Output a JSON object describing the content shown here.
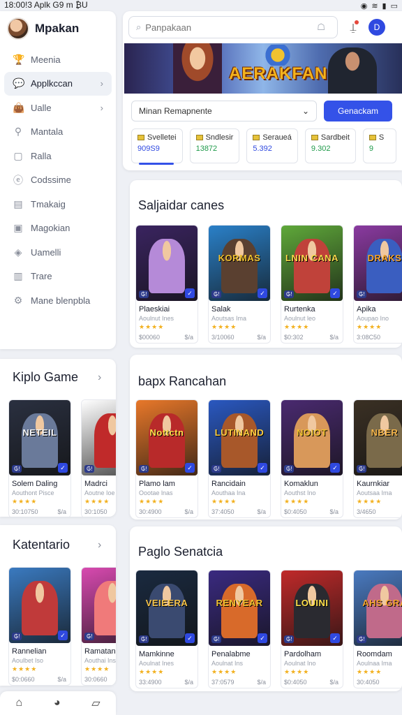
{
  "status": {
    "time": "18:00!3",
    "carrier": "Aplk G9 m ₿U"
  },
  "brand": {
    "name": "Mpakan"
  },
  "nav": [
    {
      "label": "Meenia",
      "icon": "trophy-icon",
      "glyph": "🏆",
      "active": false,
      "chevron": false
    },
    {
      "label": "Applkccan",
      "icon": "chat-icon",
      "glyph": "💬",
      "active": true,
      "chevron": true
    },
    {
      "label": "Ualle",
      "icon": "bag-icon",
      "glyph": "👜",
      "active": false,
      "chevron": true
    },
    {
      "label": "Mantala",
      "icon": "location-icon",
      "glyph": "⚲",
      "active": false,
      "chevron": false
    },
    {
      "label": "Ralla",
      "icon": "square-icon",
      "glyph": "▢",
      "active": false,
      "chevron": false
    },
    {
      "label": "Codssime",
      "icon": "circle-e-icon",
      "glyph": "ⓔ",
      "active": false,
      "chevron": false
    },
    {
      "label": "Tmakaig",
      "icon": "document-icon",
      "glyph": "▤",
      "active": false,
      "chevron": false
    },
    {
      "label": "Magokian",
      "icon": "image-icon",
      "glyph": "▣",
      "active": false,
      "chevron": false
    },
    {
      "label": "Uamelli",
      "icon": "diamond-icon",
      "glyph": "◈",
      "active": false,
      "chevron": false
    },
    {
      "label": "Trare",
      "icon": "clipboard-icon",
      "glyph": "▥",
      "active": false,
      "chevron": false
    },
    {
      "label": "Mane blenpbla",
      "icon": "settings-icon",
      "glyph": "⚙",
      "active": false,
      "chevron": false
    }
  ],
  "search": {
    "placeholder": "Panpakaan"
  },
  "header": {
    "user_initial": "D"
  },
  "banner": {
    "title": "AERAKFAN"
  },
  "filter": {
    "selected": "Minan Remapnente",
    "button": "Genackam"
  },
  "stats": [
    {
      "label": "Svelletei",
      "value": "909S9",
      "color": "#2f49e0",
      "active": true
    },
    {
      "label": "Sndlesir",
      "value": "13872",
      "color": "#1f9a4a",
      "active": false
    },
    {
      "label": "Seraueá",
      "value": "5.392",
      "color": "#2f49e0",
      "active": false
    },
    {
      "label": "Sardbeit",
      "value": "9.302",
      "color": "#1f9a4a",
      "active": false
    },
    {
      "label": "S",
      "value": "9",
      "color": "#1f9a4a",
      "active": false
    }
  ],
  "sections": {
    "s1": {
      "title": "Saljaidar canes",
      "games": [
        {
          "name": "Plaeskiai",
          "sub": "Aoulnut Ines",
          "price": "$00060",
          "tag": "$/a",
          "art_title": "",
          "bg": "#3a2460",
          "fig": "#b58ad8",
          "accent": "#f5c34a"
        },
        {
          "name": "Salak",
          "sub": "Aoutsas Ima",
          "price": "3/10060",
          "tag": "$/a",
          "art_title": "KORMAS",
          "bg": "#2a80c8",
          "fig": "#5a4030",
          "accent": "#f1c230"
        },
        {
          "name": "Rurtenka",
          "sub": "Aoulnut leo",
          "price": "$0:302",
          "tag": "$/a",
          "art_title": "LNIN CANA",
          "bg": "#5fa83a",
          "fig": "#c0423a",
          "accent": "#f6d84a"
        },
        {
          "name": "Apika",
          "sub": "Aoupao Ino",
          "price": "3:08C50",
          "tag": "$/a",
          "art_title": "DRAKS",
          "bg": "#8a3aa0",
          "fig": "#3a5ec0",
          "accent": "#f5a530"
        }
      ]
    },
    "s2": {
      "title": "bapx Rancahan",
      "games": [
        {
          "name": "Plamo lam",
          "sub": "Oootae lnas",
          "price": "30:4900",
          "tag": "$/a",
          "art_title": "Nottctn",
          "bg": "#e8782a",
          "fig": "#b82a2a",
          "accent": "#ffe04a"
        },
        {
          "name": "Rancidain",
          "sub": "Aouthaa Ina",
          "price": "37:4050",
          "tag": "$/a",
          "art_title": "LUTINAND",
          "bg": "#2a58c0",
          "fig": "#a8582a",
          "accent": "#ffd040"
        },
        {
          "name": "Komaklun",
          "sub": "Aouthst Ino",
          "price": "$0:4050",
          "tag": "$/a",
          "art_title": "NOIOT",
          "bg": "#4a2a70",
          "fig": "#d8985a",
          "accent": "#f1c230"
        },
        {
          "name": "Kaurnkiar",
          "sub": "Aoutsaa Ima",
          "price": "3/4650",
          "tag": "$/a",
          "art_title": "NBER",
          "bg": "#3a3024",
          "fig": "#7a6a4a",
          "accent": "#f5b54a"
        }
      ]
    },
    "s3": {
      "title": "Paglo Senatcia",
      "games": [
        {
          "name": "Mamkinne",
          "sub": "Aoulnat Ines",
          "price": "33:4900",
          "tag": "$/a",
          "art_title": "VEIEERA",
          "bg": "#1a2a40",
          "fig": "#3a4a70",
          "accent": "#f5c34a"
        },
        {
          "name": "Penalabme",
          "sub": "Aoulnat Ins",
          "price": "37:0579",
          "tag": "$/a",
          "art_title": "RENYEAR",
          "bg": "#3a2a80",
          "fig": "#d86a2a",
          "accent": "#f1c230"
        },
        {
          "name": "Pardolham",
          "sub": "Aoulnat Ino",
          "price": "$0:4050",
          "tag": "$/a",
          "art_title": "LOUINI",
          "bg": "#c02a2a",
          "fig": "#2a2a30",
          "accent": "#ffe04a"
        },
        {
          "name": "Roomdam",
          "sub": "Aoulnaa Ima",
          "price": "30:4050",
          "tag": "$/a",
          "art_title": "AHS GRA",
          "bg": "#4a7ac0",
          "fig": "#c06a8a",
          "accent": "#f5a530"
        }
      ]
    },
    "k1": {
      "title": "Kiplo Game",
      "games": [
        {
          "name": "Solem Daling",
          "sub": "Aouthont Pisce",
          "price": "30:10750",
          "tag": "$/a",
          "art_title": "NETEIL",
          "bg": "#2a3040",
          "fig": "#6a7a9a",
          "accent": "#f5f5f5"
        },
        {
          "name": "Madrci",
          "sub": "Aoutne Ioe",
          "price": "30:1050",
          "tag": "$/a",
          "art_title": "",
          "bg": "#ffffff",
          "fig": "#c02a2a",
          "accent": "#333"
        }
      ]
    },
    "k2": {
      "title": "Katentario",
      "games": [
        {
          "name": "Rannelian",
          "sub": "Aoulbet Iso",
          "price": "$0:0660",
          "tag": "$/a",
          "art_title": "",
          "bg": "#3a7ac0",
          "fig": "#c03a3a",
          "accent": "#f1c230"
        },
        {
          "name": "Ramatann",
          "sub": "Aouthai Ins",
          "price": "30:0660",
          "tag": "$/a",
          "art_title": "",
          "bg": "#d84ab0",
          "fig": "#f07a7a",
          "accent": "#ffe04a"
        }
      ]
    }
  },
  "bottom_nav": [
    {
      "icon": "home-icon",
      "glyph": "⌂"
    },
    {
      "icon": "game-controller-icon",
      "glyph": "◕"
    },
    {
      "icon": "document-icon",
      "glyph": "▱"
    }
  ]
}
